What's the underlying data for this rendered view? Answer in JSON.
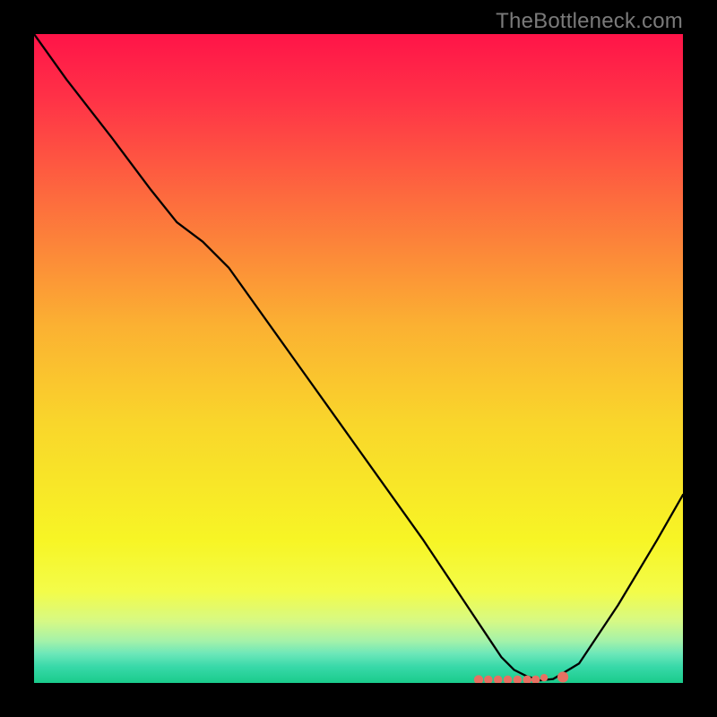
{
  "watermark": "TheBottleneck.com",
  "chart_data": {
    "type": "line",
    "title": "",
    "xlabel": "",
    "ylabel": "",
    "xlim": [
      0,
      100
    ],
    "ylim": [
      0,
      100
    ],
    "grid": false,
    "legend": false,
    "background_gradient": {
      "stops": [
        {
          "pos": 0.0,
          "color": "#ff1448"
        },
        {
          "pos": 0.1,
          "color": "#ff3247"
        },
        {
          "pos": 0.25,
          "color": "#fd6a3e"
        },
        {
          "pos": 0.45,
          "color": "#fbb132"
        },
        {
          "pos": 0.6,
          "color": "#f9d62b"
        },
        {
          "pos": 0.78,
          "color": "#f7f525"
        },
        {
          "pos": 0.86,
          "color": "#f3fc4a"
        },
        {
          "pos": 0.905,
          "color": "#d6f985"
        },
        {
          "pos": 0.935,
          "color": "#a5f2a9"
        },
        {
          "pos": 0.955,
          "color": "#6ce7b9"
        },
        {
          "pos": 0.975,
          "color": "#38d9a9"
        },
        {
          "pos": 1.0,
          "color": "#1acb8b"
        }
      ]
    },
    "series": [
      {
        "name": "bottleneck-curve",
        "stroke": "#000000",
        "stroke_width": 2.3,
        "x": [
          0,
          5,
          12,
          18,
          22,
          26,
          30,
          40,
          50,
          60,
          66,
          70,
          72,
          74,
          76,
          78,
          80,
          84,
          90,
          96,
          100
        ],
        "y": [
          100,
          93,
          84,
          76,
          71,
          68,
          64,
          50,
          36,
          22,
          13,
          7,
          4,
          2,
          1,
          0.4,
          0.6,
          3,
          12,
          22,
          29
        ]
      }
    ],
    "markers": {
      "note": "Cluster of salmon-colored dots near bottleneck minimum",
      "color": "#e77062",
      "points": [
        {
          "x": 68.5,
          "y": 0.5,
          "r": 3.2
        },
        {
          "x": 70.0,
          "y": 0.5,
          "r": 3.0
        },
        {
          "x": 71.5,
          "y": 0.5,
          "r": 3.0
        },
        {
          "x": 73.0,
          "y": 0.5,
          "r": 3.0
        },
        {
          "x": 74.5,
          "y": 0.5,
          "r": 3.0
        },
        {
          "x": 76.0,
          "y": 0.5,
          "r": 3.0
        },
        {
          "x": 77.3,
          "y": 0.5,
          "r": 3.0
        },
        {
          "x": 78.6,
          "y": 0.8,
          "r": 2.6
        },
        {
          "x": 81.5,
          "y": 0.9,
          "r": 3.8
        }
      ]
    }
  }
}
